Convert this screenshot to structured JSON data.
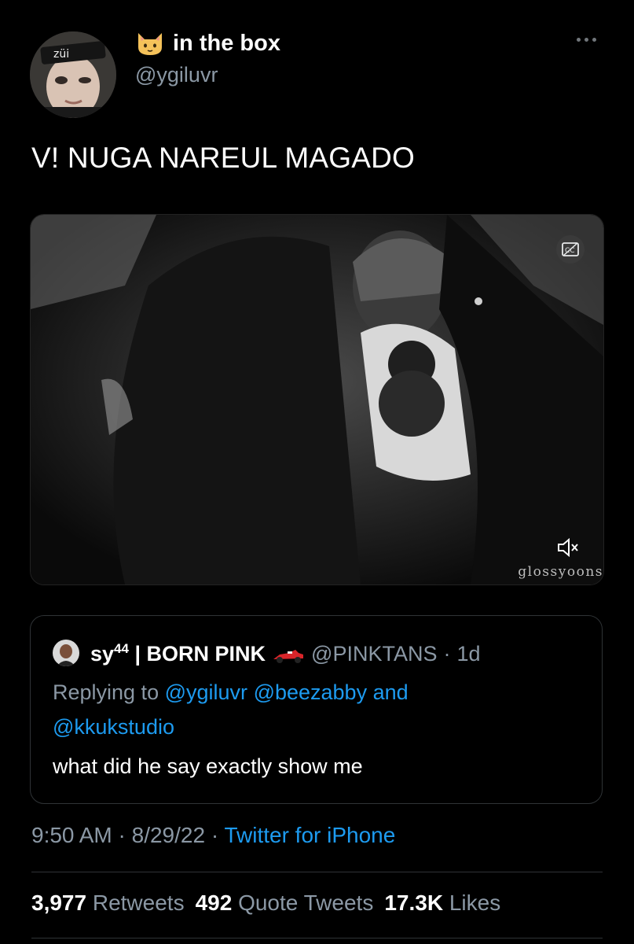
{
  "author": {
    "display_name": "in the box",
    "emoji_icon": "cat-face-icon",
    "handle": "@ygiluvr",
    "avatar_text": "züi"
  },
  "tweet": {
    "text": "V! NUGA NAREUL MAGADO"
  },
  "media": {
    "type": "video",
    "watermark": "glossyoons",
    "cc_icon": "closed-captions-icon",
    "mute_icon": "speaker-muted-icon"
  },
  "quote": {
    "display_name": "sy",
    "name_superscript": "44",
    "name_suffix": " | BORN PINK",
    "emoji_icon": "race-car-icon",
    "handle": "@PINKTANS",
    "separator": "·",
    "time": "1d",
    "replying_prefix": "Replying to",
    "mention_1": "@ygiluvr",
    "mention_2": "@beezabby",
    "and_text": "and",
    "mention_3": "@kkukstudio",
    "body": "what did he say exactly show me"
  },
  "meta": {
    "time": "9:50 AM",
    "sep1": "·",
    "date": "8/29/22",
    "sep2": "·",
    "source": "Twitter for iPhone"
  },
  "stats": {
    "retweets_count": "3,977",
    "retweets_label": "Retweets",
    "quotes_count": "492",
    "quotes_label": "Quote Tweets",
    "likes_count": "17.3K",
    "likes_label": "Likes"
  },
  "colors": {
    "background": "#000000",
    "link": "#1d9bf0",
    "secondary_text": "#8b98a5",
    "border": "#2f3336"
  }
}
